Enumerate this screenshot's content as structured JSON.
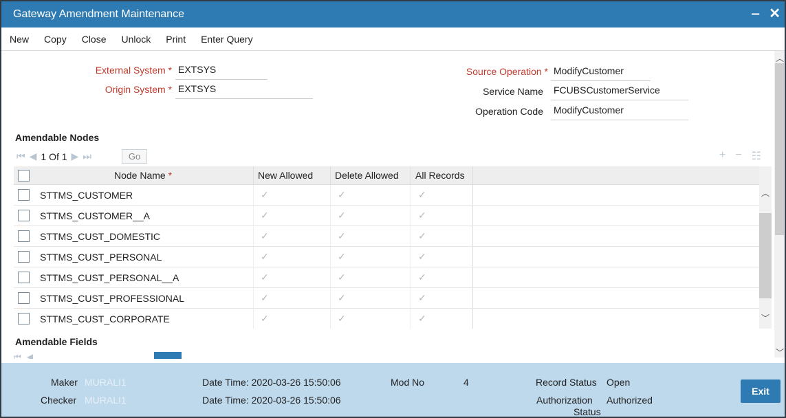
{
  "window": {
    "title": "Gateway Amendment Maintenance",
    "minimize": "‒",
    "close": "✕"
  },
  "menu": [
    "New",
    "Copy",
    "Close",
    "Unlock",
    "Print",
    "Enter Query"
  ],
  "form": {
    "external_system_label": "External System",
    "external_system_value": "EXTSYS",
    "origin_system_label": "Origin System",
    "origin_system_value": "EXTSYS",
    "source_operation_label": "Source Operation",
    "source_operation_value": "ModifyCustomer",
    "service_name_label": "Service Name",
    "service_name_value": "FCUBSCustomerService",
    "operation_code_label": "Operation Code",
    "operation_code_value": "ModifyCustomer",
    "required_mark": "*"
  },
  "amendable_nodes": {
    "title": "Amendable Nodes",
    "pager_text": "1 Of 1",
    "go_label": "Go",
    "columns": {
      "node_name": "Node Name",
      "new_allowed": "New Allowed",
      "delete_allowed": "Delete Allowed",
      "all_records": "All Records"
    },
    "rows": [
      {
        "node": "STTMS_CUSTOMER",
        "new": true,
        "delete": true,
        "all": true
      },
      {
        "node": "STTMS_CUSTOMER__A",
        "new": true,
        "delete": true,
        "all": true
      },
      {
        "node": "STTMS_CUST_DOMESTIC",
        "new": true,
        "delete": true,
        "all": true
      },
      {
        "node": "STTMS_CUST_PERSONAL",
        "new": true,
        "delete": true,
        "all": true
      },
      {
        "node": "STTMS_CUST_PERSONAL__A",
        "new": true,
        "delete": true,
        "all": true
      },
      {
        "node": "STTMS_CUST_PROFESSIONAL",
        "new": true,
        "delete": true,
        "all": true
      },
      {
        "node": "STTMS_CUST_CORPORATE",
        "new": true,
        "delete": true,
        "all": true
      }
    ]
  },
  "amendable_fields": {
    "title": "Amendable Fields"
  },
  "footer": {
    "maker_label": "Maker",
    "maker_value": "MURALI1",
    "checker_label": "Checker",
    "checker_value": "MURALI1",
    "maker_datetime": "Date Time: 2020-03-26 15:50:06",
    "checker_datetime": "Date Time: 2020-03-26 15:50:06",
    "mod_no_label": "Mod No",
    "mod_no_value": "4",
    "record_status_label": "Record Status",
    "record_status_value": "Open",
    "auth_status_label_1": "Authorization",
    "auth_status_label_2": "Status",
    "auth_status_value": "Authorized",
    "exit_label": "Exit"
  },
  "icons": {
    "check": "✓",
    "first": "⏮",
    "prev": "◀",
    "next": "▶",
    "last": "⏭",
    "add": "+",
    "remove": "−",
    "list": "☷"
  }
}
